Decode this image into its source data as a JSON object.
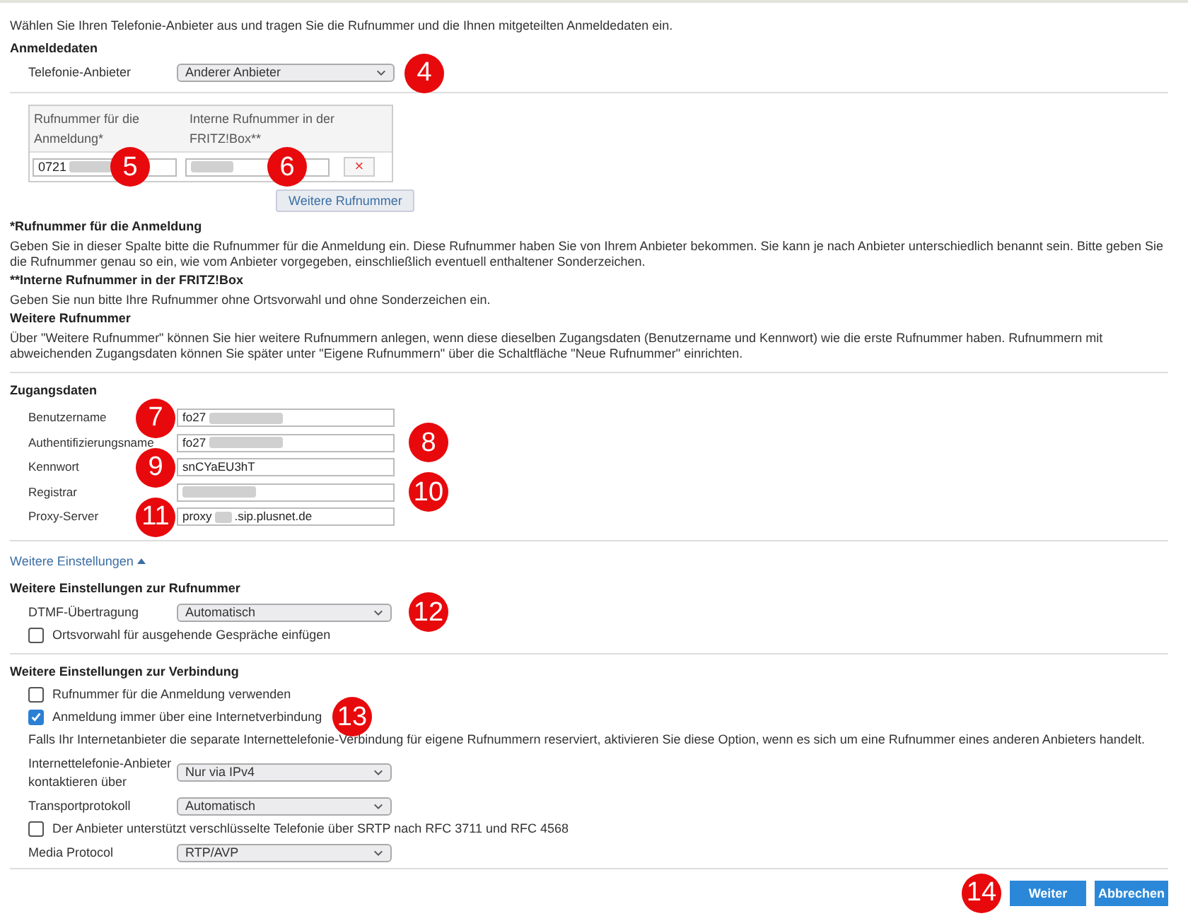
{
  "intro": "Wählen Sie Ihren Telefonie-Anbieter aus und tragen Sie die Rufnummer und die Ihnen mitgeteilten Anmeldedaten ein.",
  "login": {
    "heading": "Anmeldedaten",
    "label": "Telefonie-Anbieter",
    "value": "Anderer Anbieter",
    "callout": "4"
  },
  "numbers": {
    "columns": [
      "Rufnummer für die Anmeldung*",
      "Interne Rufnummer in der FRITZ!Box**"
    ],
    "row": [
      {
        "value": "0721",
        "redacted": true,
        "callout": "5"
      },
      {
        "redacted": true,
        "callout": "6"
      }
    ],
    "delete": "×",
    "add_button": "Weitere Rufnummer"
  },
  "notes": [
    {
      "kind": "heading",
      "text": "*Rufnummer für die Anmeldung"
    },
    {
      "kind": "text",
      "text": "Geben Sie in dieser Spalte bitte die Rufnummer für die Anmeldung ein. Diese Rufnummer haben Sie von Ihrem Anbieter bekommen. Sie kann je nach Anbieter unterschiedlich benannt sein. Bitte geben Sie die Rufnummer genau so ein, wie vom Anbieter vorgegeben, einschließlich eventuell enthaltener Sonderzeichen."
    },
    {
      "kind": "heading",
      "text": "**Interne Rufnummer in der FRITZ!Box"
    },
    {
      "kind": "text",
      "text": "Geben Sie nun bitte Ihre Rufnummer ohne Ortsvorwahl und ohne Sonderzeichen ein."
    },
    {
      "kind": "heading",
      "text": "Weitere Rufnummer"
    },
    {
      "kind": "text",
      "text": "Über \"Weitere Rufnummer\" können Sie hier weitere Rufnummern anlegen, wenn diese dieselben Zugangsdaten (Benutzername und Kennwort) wie die erste Rufnummer haben. Rufnummern mit abweichenden Zugangsdaten können Sie später unter \"Eigene Rufnummern\" über die Schaltfläche \"Neue Rufnummer\" einrichten."
    }
  ],
  "access": {
    "heading": "Zugangsdaten",
    "fields": [
      {
        "label": "Benutzername",
        "value": "fo27",
        "redacted": true,
        "callout": "7"
      },
      {
        "label": "Authentifizierungsname",
        "value": "fo27",
        "redacted": true,
        "callout": "8"
      },
      {
        "label": "Kennwort",
        "value": "snCYaEU3hT",
        "callout": "9"
      },
      {
        "label": "Registrar",
        "redacted": true,
        "callout": "10"
      },
      {
        "label": "Proxy-Server",
        "value": "proxy",
        "value_after": ".sip.plusnet.de",
        "redacted": true,
        "callout": "11"
      }
    ]
  },
  "more_link": {
    "label": "Weitere Einstellungen",
    "expanded": true
  },
  "number_settings": {
    "heading": "Weitere Einstellungen zur Rufnummer",
    "items": [
      {
        "kind": "select",
        "label": "DTMF-Übertragung",
        "value": "Automatisch",
        "callout": "12"
      },
      {
        "kind": "checkbox",
        "label": "Ortsvorwahl für ausgehende Gespräche einfügen",
        "checked": false
      }
    ]
  },
  "connection_settings": {
    "heading": "Weitere Einstellungen zur Verbindung",
    "items": [
      {
        "kind": "checkbox",
        "label": "Rufnummer für die Anmeldung verwenden",
        "checked": false
      },
      {
        "kind": "checkbox",
        "label": "Anmeldung immer über eine Internetverbindung",
        "checked": true,
        "callout": "13"
      },
      {
        "kind": "text",
        "label": "Falls Ihr Internetanbieter die separate Internettelefonie-Verbindung für eigene Rufnummern reserviert, aktivieren Sie diese Option, wenn es sich um eine Rufnummer eines anderen Anbieters handelt."
      },
      {
        "kind": "select",
        "label": "Internettelefonie-Anbieter kontaktieren über",
        "value": "Nur via IPv4"
      },
      {
        "kind": "select",
        "label": "Transportprotokoll",
        "value": "Automatisch"
      },
      {
        "kind": "checkbox",
        "label": "Der Anbieter unterstützt verschlüsselte Telefonie über SRTP nach RFC 3711 und RFC 4568",
        "checked": false
      },
      {
        "kind": "select",
        "label": "Media Protocol",
        "value": "RTP/AVP"
      }
    ]
  },
  "buttons": [
    {
      "label": "Weiter"
    },
    {
      "label": "Abbrechen"
    }
  ],
  "footer_callout": "14"
}
